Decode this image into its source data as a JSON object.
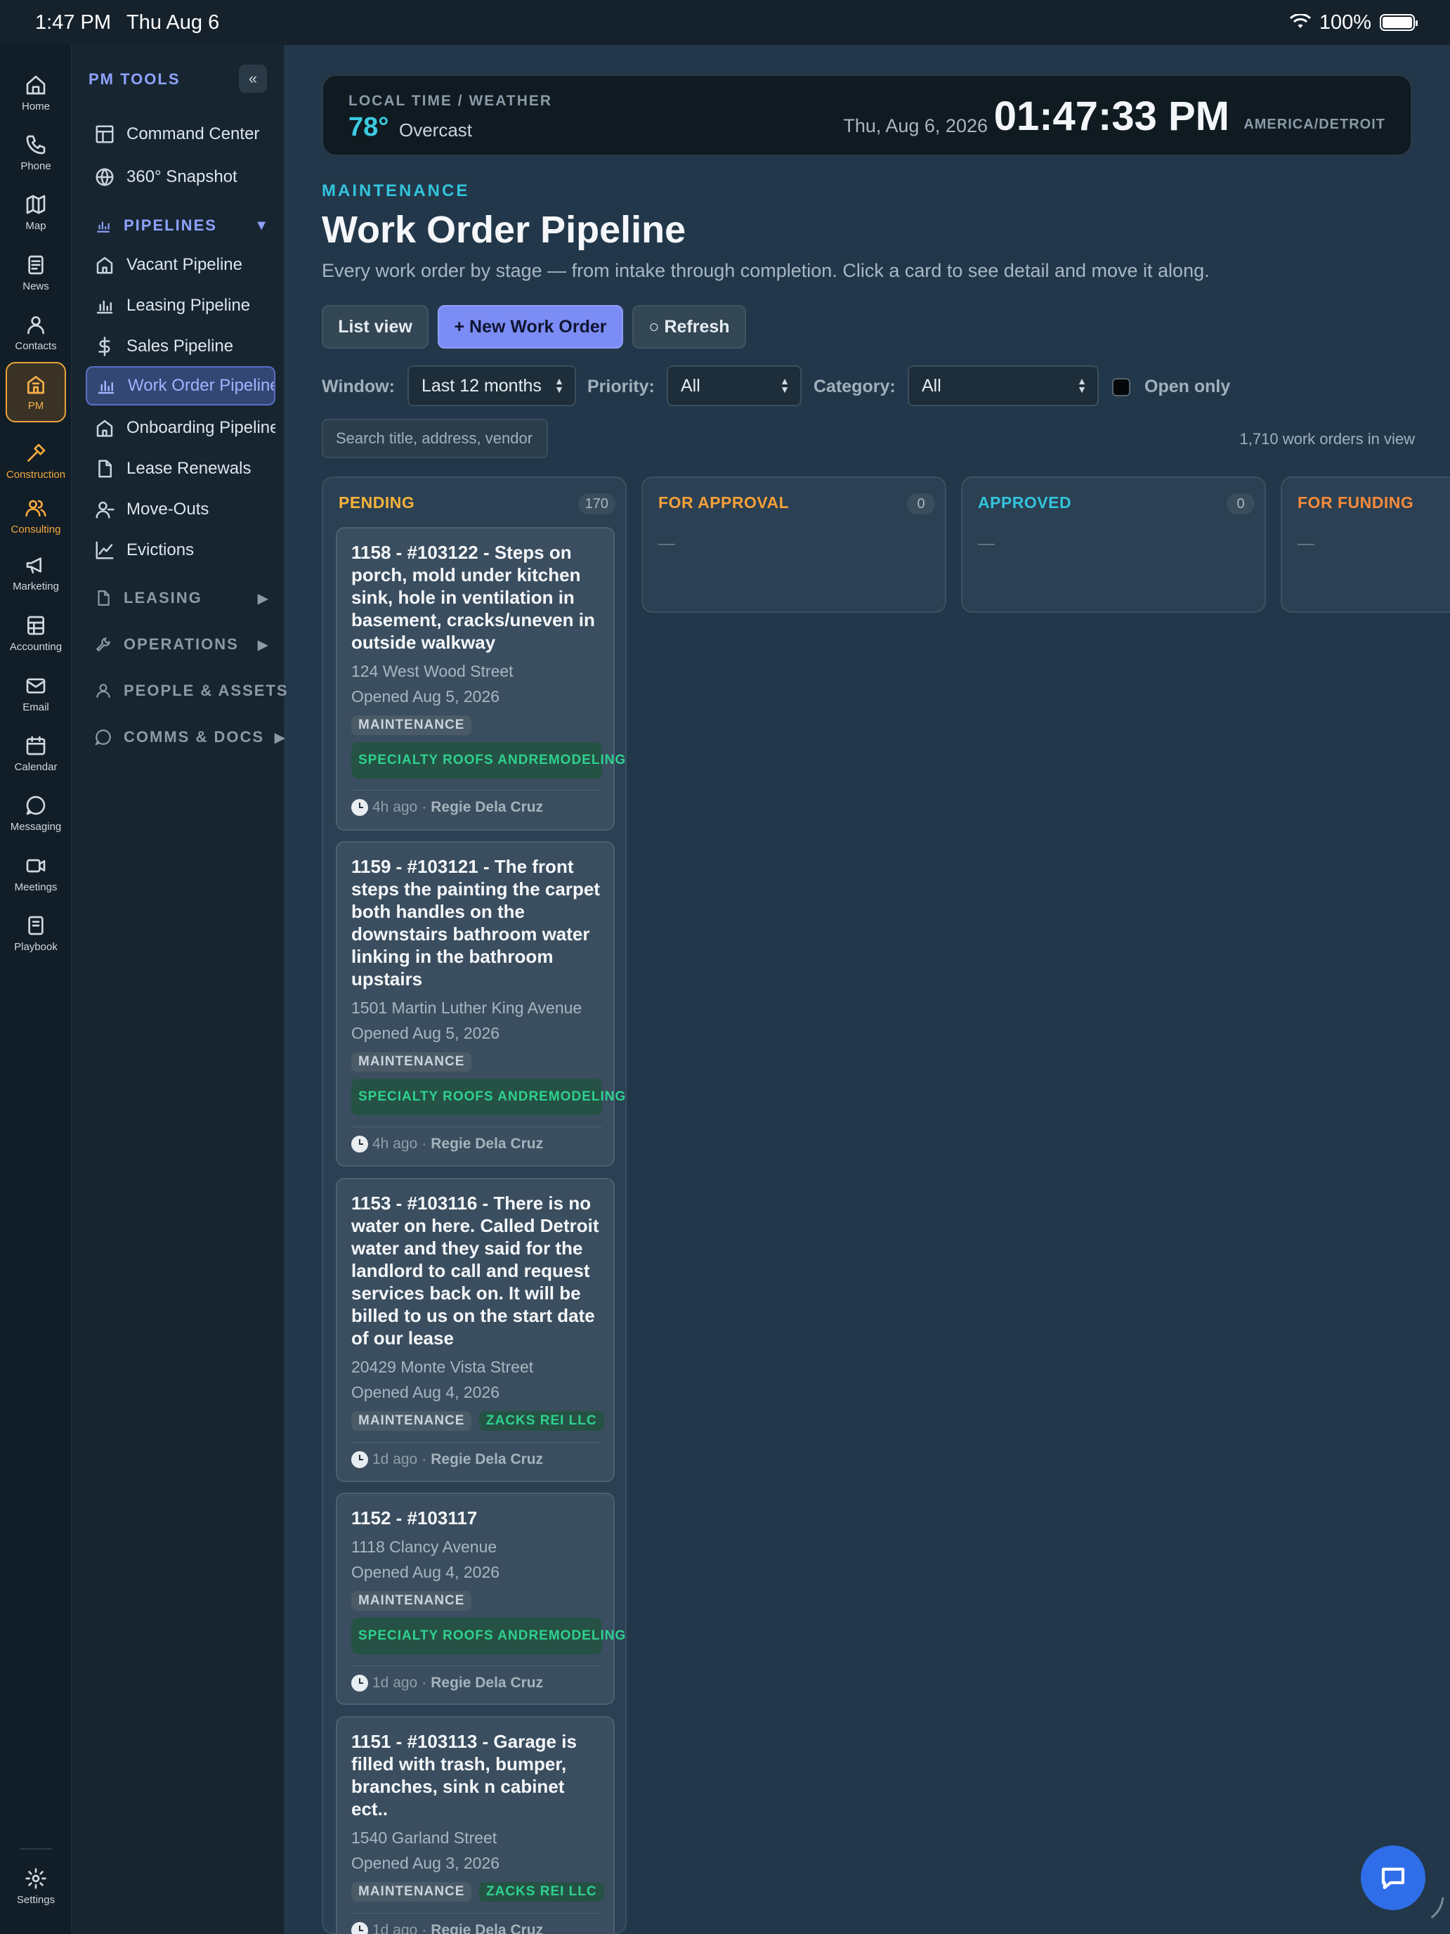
{
  "status_bar": {
    "time": "1:47 PM",
    "date": "Thu Aug 6",
    "battery": "100%"
  },
  "rail": {
    "items": [
      {
        "label": "Home",
        "icon": "home-icon"
      },
      {
        "label": "Phone",
        "icon": "phone-icon"
      },
      {
        "label": "Map",
        "icon": "map-icon"
      },
      {
        "label": "News",
        "icon": "news-icon"
      },
      {
        "label": "Contacts",
        "icon": "contacts-icon"
      },
      {
        "label": "PM",
        "icon": "building-icon"
      },
      {
        "label": "Construction",
        "icon": "hammer-icon"
      },
      {
        "label": "Consulting",
        "icon": "people-icon"
      },
      {
        "label": "Marketing",
        "icon": "megaphone-icon"
      },
      {
        "label": "Accounting",
        "icon": "ledger-icon"
      },
      {
        "label": "Email",
        "icon": "mail-icon"
      },
      {
        "label": "Calendar",
        "icon": "calendar-icon"
      },
      {
        "label": "Messaging",
        "icon": "chat-icon"
      },
      {
        "label": "Meetings",
        "icon": "video-icon"
      },
      {
        "label": "Playbook",
        "icon": "book-icon"
      }
    ],
    "settings": "Settings"
  },
  "panel": {
    "title": "PM TOOLS",
    "collapse": "«",
    "top_items": [
      "Command Center",
      "360° Snapshot"
    ],
    "pipelines_label": "PIPELINES",
    "pipelines_arrow": "▼",
    "pipelines": [
      "Vacant Pipeline",
      "Leasing Pipeline",
      "Sales Pipeline",
      "Work Order Pipeline",
      "Onboarding Pipeline",
      "Lease Renewals",
      "Move-Outs",
      "Evictions"
    ],
    "sections": [
      {
        "label": "LEASING",
        "arrow": "▶"
      },
      {
        "label": "OPERATIONS",
        "arrow": "▶"
      },
      {
        "label": "PEOPLE & ASSETS",
        "arrow": ""
      },
      {
        "label": "COMMS & DOCS",
        "arrow": "▶"
      }
    ]
  },
  "weather": {
    "label": "LOCAL TIME / WEATHER",
    "temp": "78°",
    "condition": "Overcast",
    "date": "Thu, Aug 6, 2026",
    "clock": "01:47:33 PM",
    "tz": "AMERICA/DETROIT"
  },
  "header": {
    "eyebrow": "MAINTENANCE",
    "title": "Work Order Pipeline",
    "subtitle": "Every work order by stage — from intake through completion. Click a card to see detail and move it along."
  },
  "actions": {
    "list_view": "List view",
    "new": "+ New Work Order",
    "refresh": "○ Refresh"
  },
  "filters": {
    "window_label": "Window:",
    "window_value": "Last 12 months",
    "priority_label": "Priority:",
    "priority_value": "All",
    "category_label": "Category:",
    "category_value": "All",
    "open_only": "Open only",
    "search_placeholder": "Search title, address, vendor",
    "count": "1,710 work orders in view"
  },
  "columns": [
    {
      "title": "PENDING",
      "count": "170",
      "color": "#f5b33b"
    },
    {
      "title": "FOR APPROVAL",
      "count": "0",
      "color": "#f5a03b",
      "empty": "—"
    },
    {
      "title": "APPROVED",
      "count": "0",
      "color": "#33c3dc",
      "empty": "—"
    },
    {
      "title": "FOR FUNDING",
      "count": "",
      "color": "#f58a3b",
      "empty": "—"
    }
  ],
  "cards": [
    {
      "title": "1158 - #103122 - Steps on porch, mold under kitchen sink, hole in ventilation in basement, cracks/uneven in outside walkway",
      "address": "124 West Wood Street",
      "opened": "Opened Aug 5, 2026",
      "tag1": "MAINTENANCE",
      "vendor_l1": "SPECIALTY ROOFS AND",
      "vendor_l2": "REMODELING",
      "age": "4h ago",
      "sep": "·",
      "user": "Regie Dela Cruz"
    },
    {
      "title": "1159 - #103121 - The front steps the painting the carpet both handles on the downstairs bathroom water linking in the bathroom upstairs",
      "address": "1501 Martin Luther King Avenue",
      "opened": "Opened Aug 5, 2026",
      "tag1": "MAINTENANCE",
      "vendor_l1": "SPECIALTY ROOFS AND",
      "vendor_l2": "REMODELING",
      "age": "4h ago",
      "sep": "·",
      "user": "Regie Dela Cruz"
    },
    {
      "title": "1153 - #103116 - There is no water on here. Called Detroit water and they said for the landlord to call and request services back on. It will be billed to us on the start date of our lease",
      "address": "20429 Monte Vista Street",
      "opened": "Opened Aug 4, 2026",
      "tag1": "MAINTENANCE",
      "vendor": "ZACKS REI LLC",
      "age": "1d ago",
      "sep": "·",
      "user": "Regie Dela Cruz"
    },
    {
      "title": "1152 - #103117",
      "address": "1118 Clancy Avenue",
      "opened": "Opened Aug 4, 2026",
      "tag1": "MAINTENANCE",
      "vendor_l1": "SPECIALTY ROOFS AND",
      "vendor_l2": "REMODELING",
      "age": "1d ago",
      "sep": "·",
      "user": "Regie Dela Cruz"
    },
    {
      "title": "1151 - #103113 - Garage is filled with trash, bumper, branches, sink n cabinet ect..",
      "address": "1540 Garland Street",
      "opened": "Opened Aug 3, 2026",
      "tag1": "MAINTENANCE",
      "vendor": "ZACKS REI LLC",
      "age": "1d ago",
      "sep": "·",
      "user": "Regie Dela Cruz"
    }
  ]
}
